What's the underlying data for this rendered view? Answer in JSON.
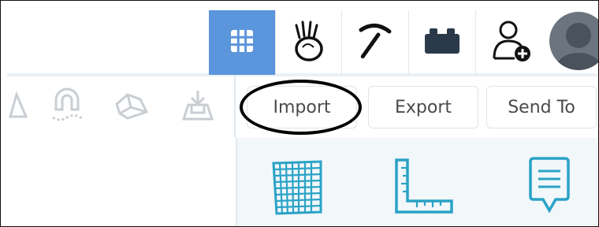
{
  "topbar": {
    "buttons": [
      {
        "icon": "grid-icon",
        "active": true
      },
      {
        "icon": "hand-stone-icon",
        "active": false
      },
      {
        "icon": "pickaxe-icon",
        "active": false
      },
      {
        "icon": "brick-icon",
        "active": false
      },
      {
        "icon": "add-user-icon",
        "active": false
      }
    ],
    "active_color": "#5b95dc",
    "avatar": "user-avatar"
  },
  "toolbar": {
    "icons": [
      "triangle-icon",
      "magnet-icon",
      "stamp-icon",
      "download-tray-icon"
    ],
    "import_label": "Import",
    "export_label": "Export",
    "send_to_label": "Send To"
  },
  "panel": {
    "icons": [
      "grid-surface-icon",
      "ruler-l-icon",
      "note-icon"
    ],
    "accent": "#2aa3c6"
  }
}
